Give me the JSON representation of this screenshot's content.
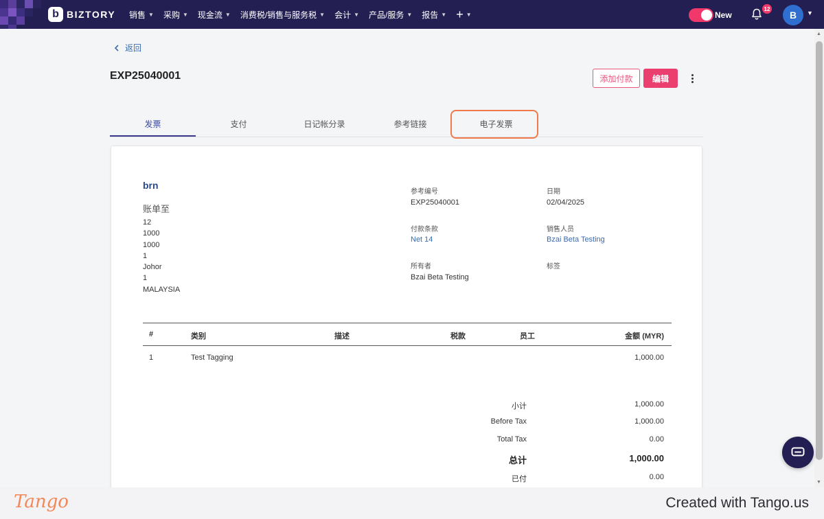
{
  "nav": {
    "brand": "BIZTORY",
    "menu": [
      {
        "label": "销售"
      },
      {
        "label": "采购"
      },
      {
        "label": "现金流"
      },
      {
        "label": "消费税/销售与服务税"
      },
      {
        "label": "会计"
      },
      {
        "label": "产品/服务"
      },
      {
        "label": "报告"
      }
    ],
    "plus": "+",
    "toggle_label": "New",
    "notif_count": "12",
    "avatar_initial": "B"
  },
  "page": {
    "back_label": "返回",
    "doc_number": "EXP25040001",
    "add_payment_label": "添加付款",
    "edit_label": "编辑",
    "tabs": [
      {
        "label": "发票"
      },
      {
        "label": "支付"
      },
      {
        "label": "日记帐分录"
      },
      {
        "label": "参考链接"
      },
      {
        "label": "电子发票"
      }
    ]
  },
  "invoice": {
    "vendor": "brn",
    "bill_to_label": "账单至",
    "address": [
      "12",
      "1000",
      "1000",
      "1",
      "Johor",
      "1",
      "MALAYSIA"
    ],
    "meta": {
      "ref_label": "参考编号",
      "ref_value": "EXP25040001",
      "date_label": "日期",
      "date_value": "02/04/2025",
      "terms_label": "付款条款",
      "terms_value": "Net 14",
      "sales_label": "销售人员",
      "sales_value": "Bzai Beta Testing",
      "owner_label": "所有者",
      "owner_value": "Bzai Beta Testing",
      "tags_label": "标签"
    },
    "table": {
      "headers": {
        "num": "#",
        "category": "类别",
        "desc": "描述",
        "tax": "税款",
        "employee": "员工",
        "amount": "金额 (MYR)"
      },
      "rows": [
        {
          "num": "1",
          "category": "Test Tagging",
          "desc": "",
          "tax": "",
          "employee": "",
          "amount": "1,000.00"
        }
      ]
    },
    "summary": {
      "subtotal_label": "小计",
      "subtotal": "1,000.00",
      "before_tax_label": "Before Tax",
      "before_tax": "1,000.00",
      "total_tax_label": "Total Tax",
      "total_tax": "0.00",
      "total_label": "总计",
      "total": "1,000.00",
      "paid_label": "已付",
      "paid": "0.00"
    }
  },
  "footer": {
    "logo": "Tango",
    "created": "Created with Tango.us"
  },
  "colors": {
    "nav_bg": "#231f52",
    "accent_pink": "#ea3f6f",
    "link_blue": "#3a6bb0",
    "highlight_orange": "#f07a4a"
  }
}
